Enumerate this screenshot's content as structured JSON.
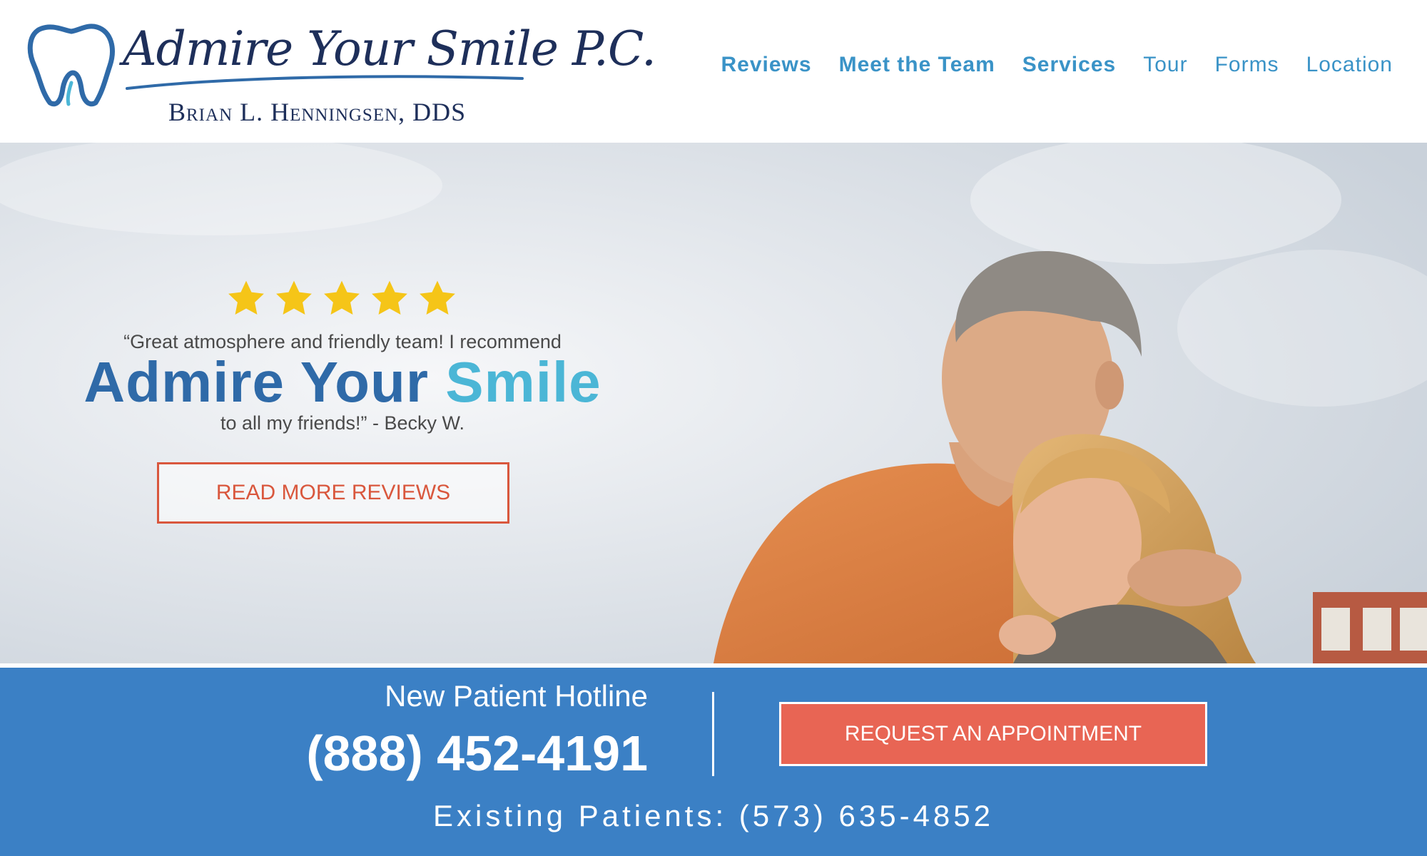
{
  "header": {
    "logo_title": "Admire Your Smile P.C.",
    "logo_subtitle": "Brian L. Henningsen, DDS",
    "nav": [
      {
        "label": "Reviews"
      },
      {
        "label": "Meet the Team"
      },
      {
        "label": "Services"
      },
      {
        "label": "Tour"
      },
      {
        "label": "Forms"
      },
      {
        "label": "Location"
      }
    ]
  },
  "hero": {
    "rating_stars": 5,
    "quote_line1": "“Great atmosphere and friendly team! I recommend",
    "headline_main": "Admire Your ",
    "headline_accent": "Smile",
    "quote_line2": "to all my friends!” - Becky W.",
    "reviews_button": "READ MORE REVIEWS"
  },
  "band": {
    "hotline_label": "New Patient Hotline",
    "hotline_number": "(888) 452-4191",
    "appointment_button": "REQUEST AN APPOINTMENT",
    "existing_patients": "Existing Patients: (573) 635-4852"
  },
  "colors": {
    "nav_link": "#3a93c7",
    "logo_navy": "#1e2f5a",
    "headline_blue": "#2f6aa8",
    "headline_accent": "#4bb6d6",
    "reviews_button": "#d9573d",
    "band_blue": "#3b80c5",
    "appointment_button": "#e86554",
    "star_gold": "#f5c518"
  },
  "icons": {
    "logo": "tooth-icon",
    "rating": "star-icon"
  }
}
